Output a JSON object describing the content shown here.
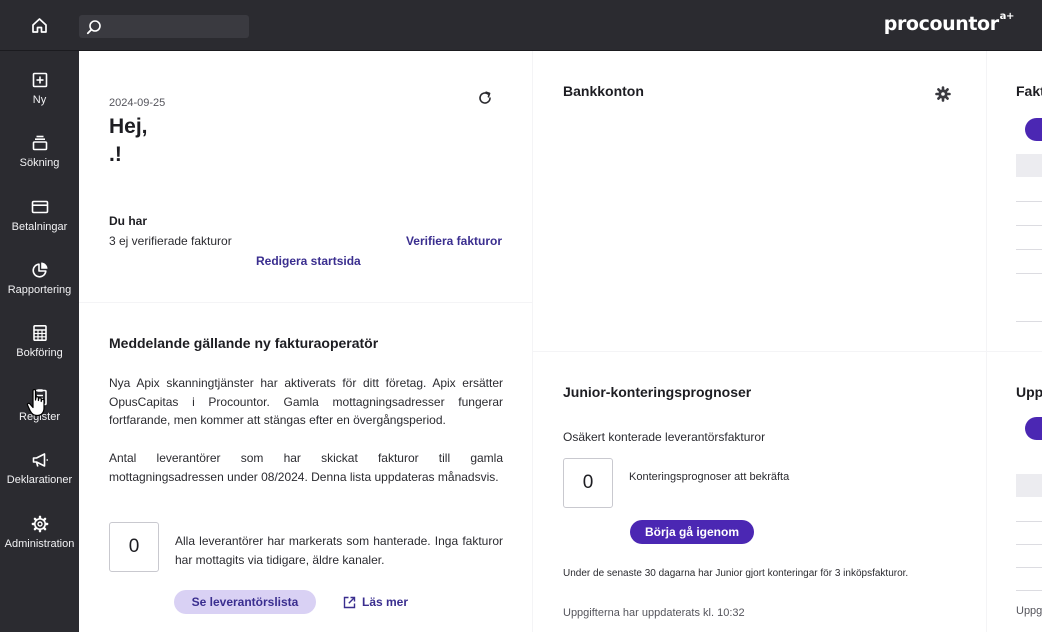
{
  "topbar": {
    "logo": "procountor",
    "logo_suffix": "a+",
    "search_placeholder": "",
    "icons": [
      "home-icon",
      "search-icon"
    ]
  },
  "sidebar": {
    "items": [
      {
        "label": "Ny",
        "icon": "plus-square-icon"
      },
      {
        "label": "Sökning",
        "icon": "stack-icon"
      },
      {
        "label": "Betalningar",
        "icon": "credit-card-icon"
      },
      {
        "label": "Rapportering",
        "icon": "pie-chart-icon"
      },
      {
        "label": "Bokföring",
        "icon": "calculator-icon"
      },
      {
        "label": "Register",
        "icon": "clipboard-icon"
      },
      {
        "label": "Deklarationer",
        "icon": "megaphone-icon"
      },
      {
        "label": "Administration",
        "icon": "gear-icon"
      }
    ]
  },
  "welcome": {
    "date": "2024-09-25",
    "greeting": "Hej,",
    "name": ".!",
    "du_har": "Du har",
    "unverified": "3 ej verifierade fakturor",
    "verify_link": "Verifiera fakturor",
    "edit_link": "Redigera startsida"
  },
  "notice": {
    "title": "Meddelande gällande ny fakturaoperatör",
    "paragraph1": "Nya Apix skanningtjänster har aktiverats för ditt företag. Apix ersätter OpusCapitas i Procountor. Gamla mottagningsadresser fungerar fortfarande, men kommer att stängas efter en övergångsperiod.",
    "paragraph2": "Antal leverantörer som har skickat fakturor till gamla mottagningsadressen under 08/2024. Denna lista uppdateras månadsvis.",
    "count": "0",
    "count_text": "Alla leverantörer har markerats som hanterade. Inga fakturor har mottagits via tidigare, äldre kanaler.",
    "supplier_button": "Se leverantörslista",
    "read_more": "Läs mer"
  },
  "bank": {
    "title": "Bankkonton"
  },
  "junior": {
    "title": "Junior-konteringsprognoser",
    "subtitle": "Osäkert konterade leverantörsfakturor",
    "count": "0",
    "count_label": "Konteringsprognoser att bekräfta",
    "button": "Börja gå igenom",
    "note": "Under de senaste 30 dagarna har Junior gjort konteringar för 3 inköpsfakturor.",
    "updated": "Uppgifterna har uppdaterats kl. 10:32"
  },
  "right_top": {
    "title": "Fakt"
  },
  "right_bottom": {
    "title": "Upp",
    "footer": "Uppg"
  },
  "colors": {
    "sidebar_bg": "#2b2b30",
    "accent": "#4b27b3",
    "accent_light": "#d9d1f4",
    "link": "#3a2e8f"
  }
}
